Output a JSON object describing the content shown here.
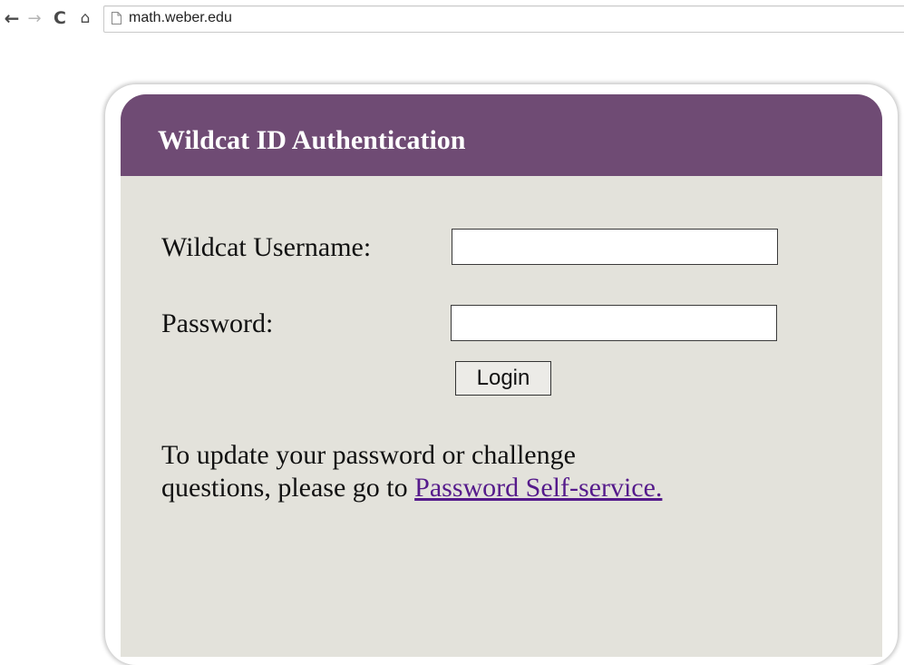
{
  "browser": {
    "url": "math.weber.edu",
    "back_icon": "←",
    "forward_icon": "→",
    "reload_icon": "C",
    "home_icon": "⌂",
    "icons": [
      "back-arrow-icon",
      "forward-arrow-icon",
      "reload-icon",
      "home-icon",
      "page-icon"
    ]
  },
  "card": {
    "title": "Wildcat ID Authentication",
    "header_color": "#6f4b74",
    "body_color": "#e3e2db"
  },
  "form": {
    "username_label": "Wildcat Username:",
    "username_value": "",
    "password_label": "Password:",
    "password_value": "",
    "login_label": "Login"
  },
  "help": {
    "text": "To update your password or challenge questions, please go to ",
    "link_text": "Password Self-service.",
    "link_color": "#551a8b"
  }
}
